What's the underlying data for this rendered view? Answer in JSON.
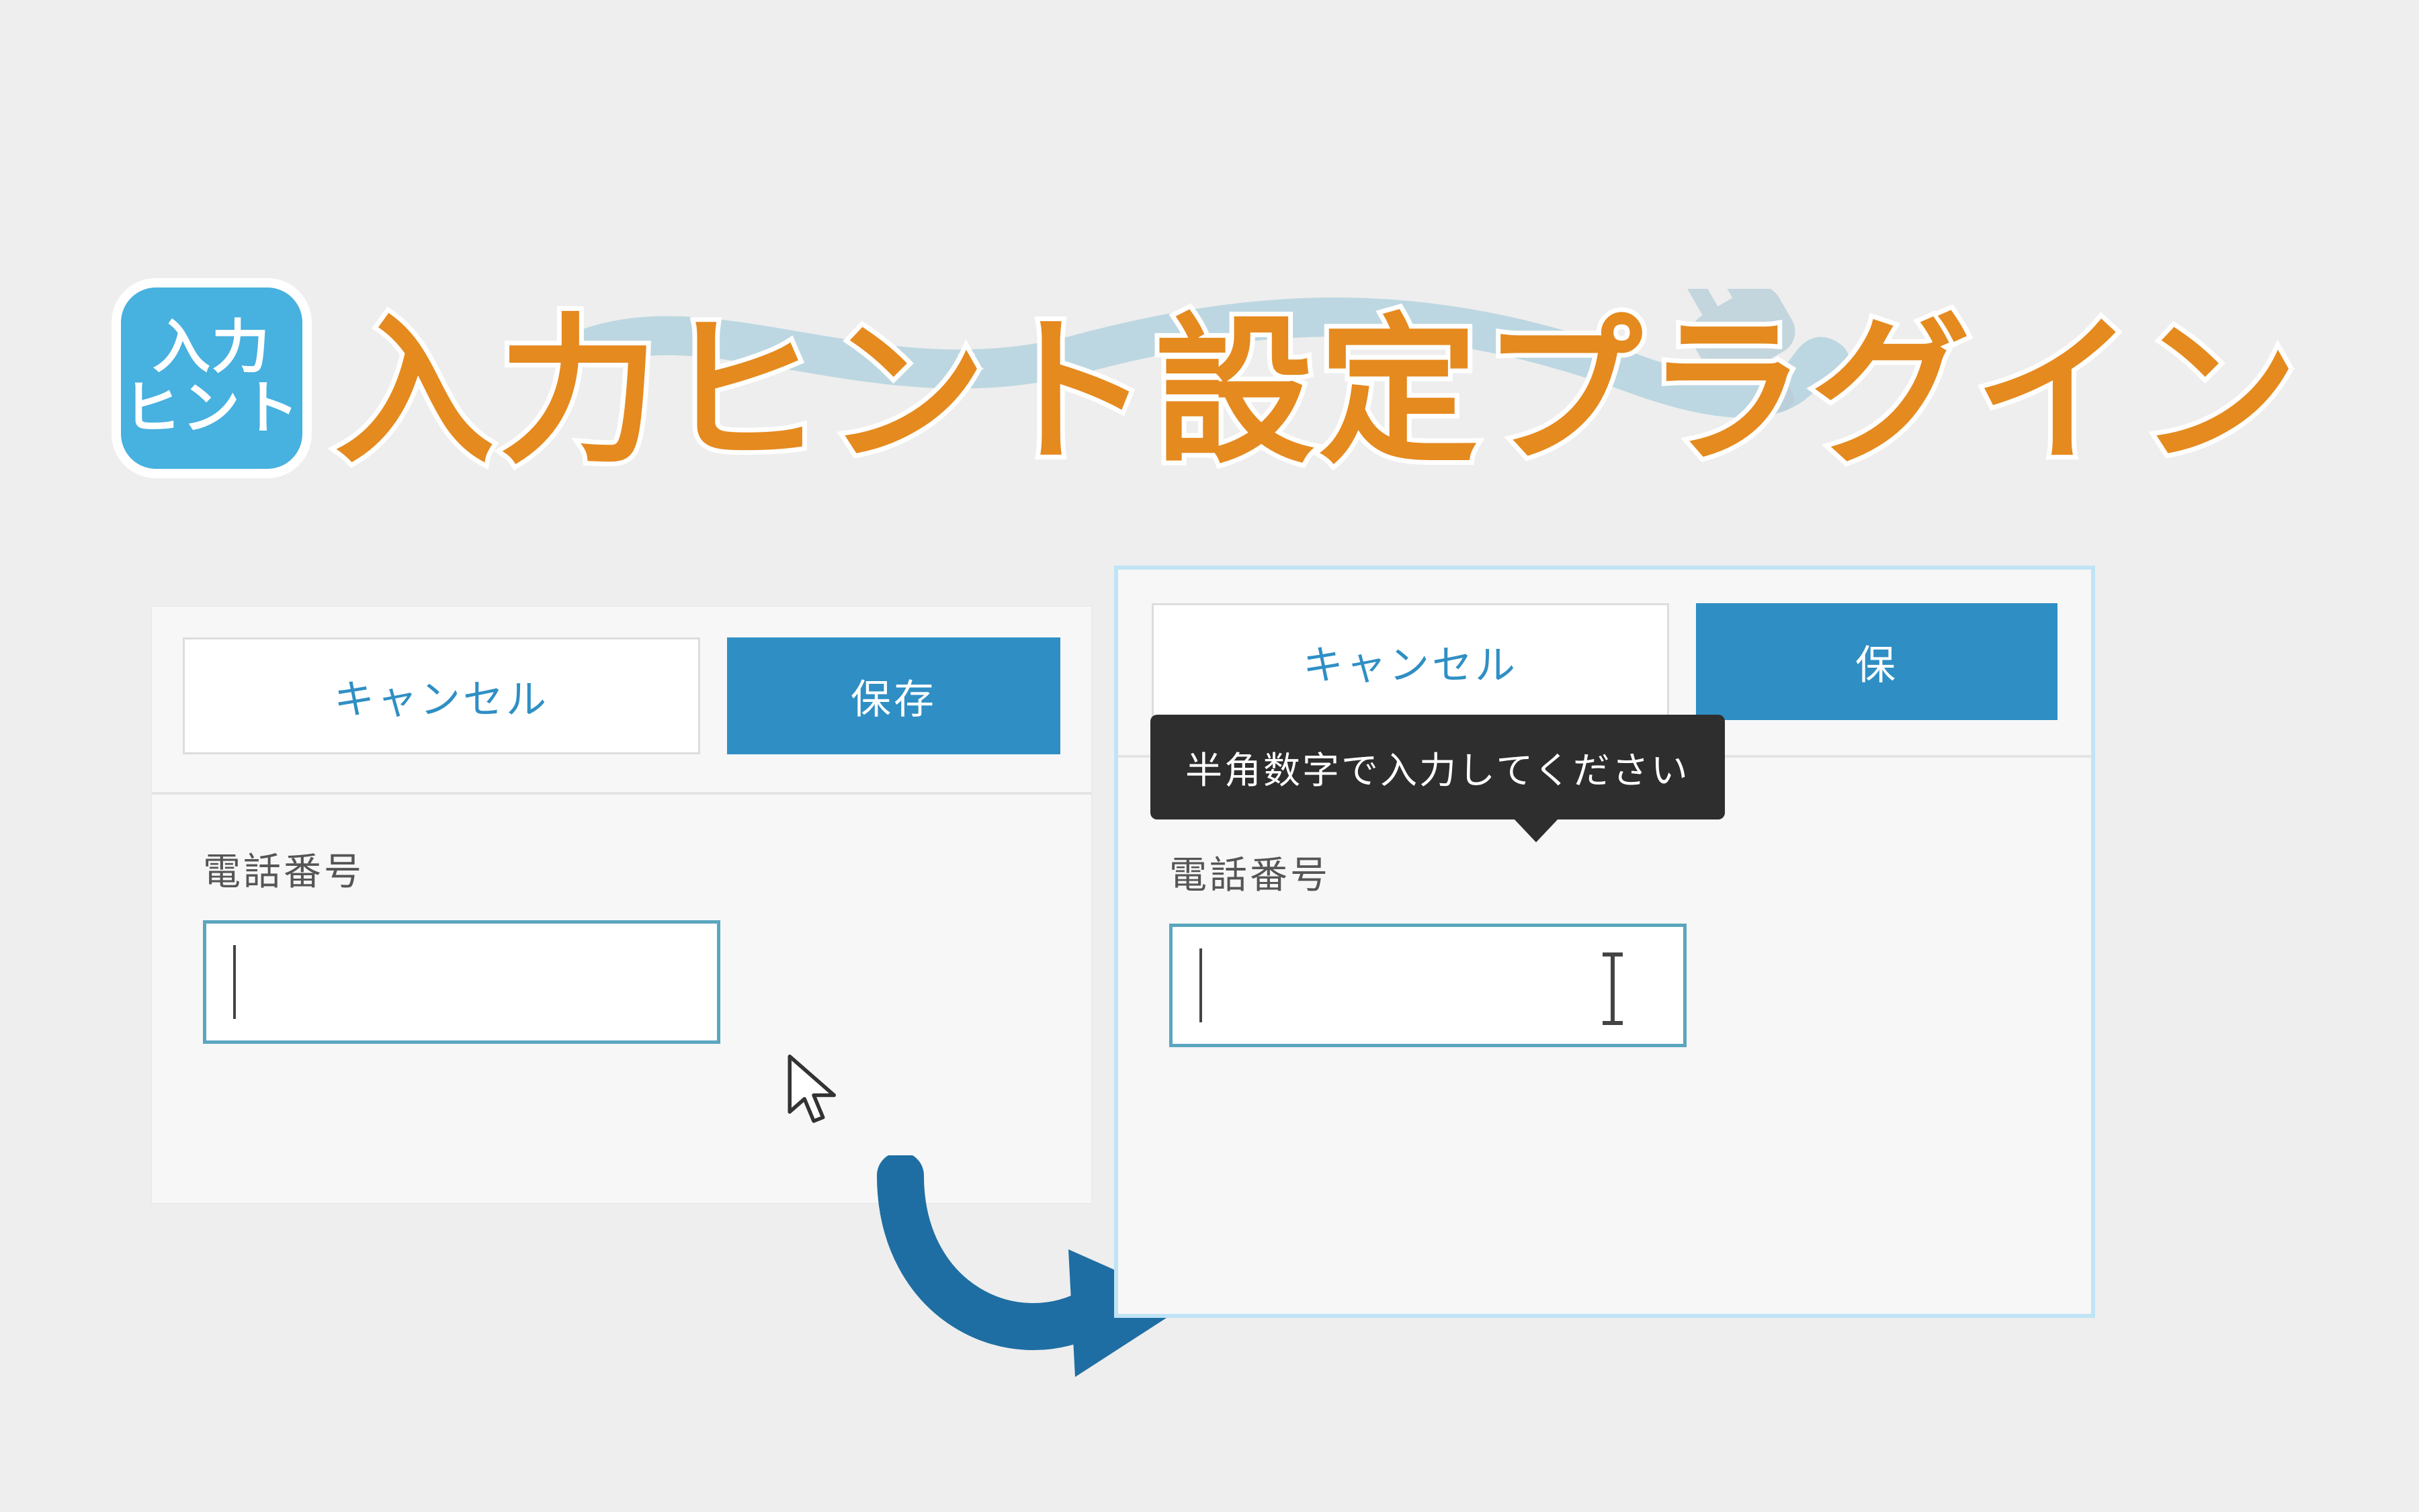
{
  "title": "入力ヒント設定プラグイン",
  "app_icon": {
    "line1": "入力",
    "line2": "ヒント"
  },
  "panels": {
    "left": {
      "cancel_label": "キャンセル",
      "save_label": "保存",
      "field_label": "電話番号",
      "input_value": ""
    },
    "right": {
      "cancel_label": "キャンセル",
      "save_label_partial": "保",
      "field_label": "電話番号",
      "input_value": "",
      "tooltip_text": "半角数字で入力してください"
    }
  },
  "icons": {
    "cursor": "cursor-arrow-icon",
    "ibeam": "text-ibeam-icon",
    "transition_arrow": "curved-right-arrow-icon",
    "plug": "plug-icon"
  },
  "colors": {
    "accent": "#e58a1f",
    "primary": "#2f8fc4",
    "icon_bg": "#47b1e0",
    "tooltip_bg": "#2e2e2e"
  }
}
